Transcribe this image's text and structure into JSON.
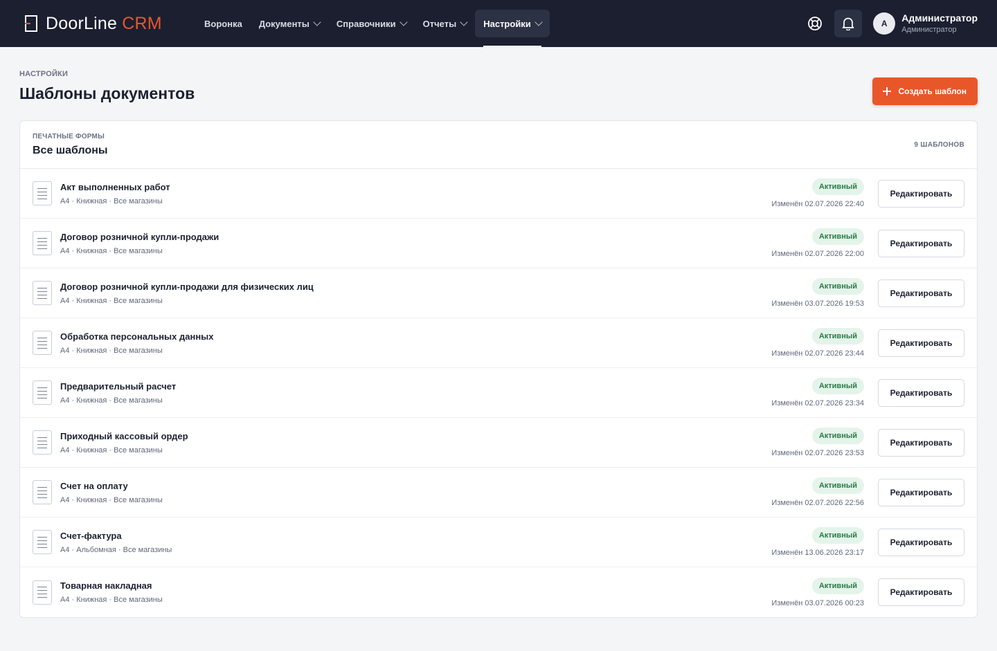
{
  "app": {
    "logo_main": "DoorLine",
    "logo_accent": "CRM"
  },
  "nav": [
    {
      "label": "Воронка",
      "dropdown": false,
      "active": false
    },
    {
      "label": "Документы",
      "dropdown": true,
      "active": false
    },
    {
      "label": "Справочники",
      "dropdown": true,
      "active": false
    },
    {
      "label": "Отчеты",
      "dropdown": true,
      "active": false
    },
    {
      "label": "Настройки",
      "dropdown": true,
      "active": true
    }
  ],
  "user": {
    "initial": "A",
    "name": "Администратор",
    "role": "Администратор"
  },
  "page": {
    "breadcrumb": "НАСТРОЙКИ",
    "title": "Шаблоны документов",
    "create_label": "Создать шаблон"
  },
  "card": {
    "kicker": "ПЕЧАТНЫЕ ФОРМЫ",
    "title": "Все шаблоны",
    "count": "9 ШАБЛОНОВ"
  },
  "templates": [
    {
      "name": "Акт выполненных работ",
      "meta": "A4 · Книжная · Все магазины",
      "status": "Активный",
      "modified": "Изменён 02.07.2026 22:40",
      "action": "Редактировать"
    },
    {
      "name": "Договор розничной купли-продажи",
      "meta": "A4 · Книжная · Все магазины",
      "status": "Активный",
      "modified": "Изменён 02.07.2026 22:00",
      "action": "Редактировать"
    },
    {
      "name": "Договор розничной купли-продажи для физических лиц",
      "meta": "A4 · Книжная · Все магазины",
      "status": "Активный",
      "modified": "Изменён 03.07.2026 19:53",
      "action": "Редактировать"
    },
    {
      "name": "Обработка персональных данных",
      "meta": "A4 · Книжная · Все магазины",
      "status": "Активный",
      "modified": "Изменён 02.07.2026 23:44",
      "action": "Редактировать"
    },
    {
      "name": "Предварительный расчет",
      "meta": "A4 · Книжная · Все магазины",
      "status": "Активный",
      "modified": "Изменён 02.07.2026 23:34",
      "action": "Редактировать"
    },
    {
      "name": "Приходный кассовый ордер",
      "meta": "A4 · Книжная · Все магазины",
      "status": "Активный",
      "modified": "Изменён 02.07.2026 23:53",
      "action": "Редактировать"
    },
    {
      "name": "Счет на оплату",
      "meta": "A4 · Книжная · Все магазины",
      "status": "Активный",
      "modified": "Изменён 02.07.2026 22:56",
      "action": "Редактировать"
    },
    {
      "name": "Счет-фактура",
      "meta": "A4 · Альбомная · Все магазины",
      "status": "Активный",
      "modified": "Изменён 13.06.2026 23:17",
      "action": "Редактировать"
    },
    {
      "name": "Товарная накладная",
      "meta": "A4 · Книжная · Все магазины",
      "status": "Активный",
      "modified": "Изменён 03.07.2026 00:23",
      "action": "Редактировать"
    }
  ],
  "icons": {
    "help": "lifebuoy-icon",
    "notifications": "bell-icon",
    "create": "plus-icon",
    "document": "document-icon",
    "dropdown": "chevron-down-icon",
    "logo": "door-icon"
  },
  "colors": {
    "topbar": "#1b1f30",
    "accent": "#e8572a",
    "status_active_bg": "#e4f4ea",
    "status_active_text": "#2a7a47"
  }
}
